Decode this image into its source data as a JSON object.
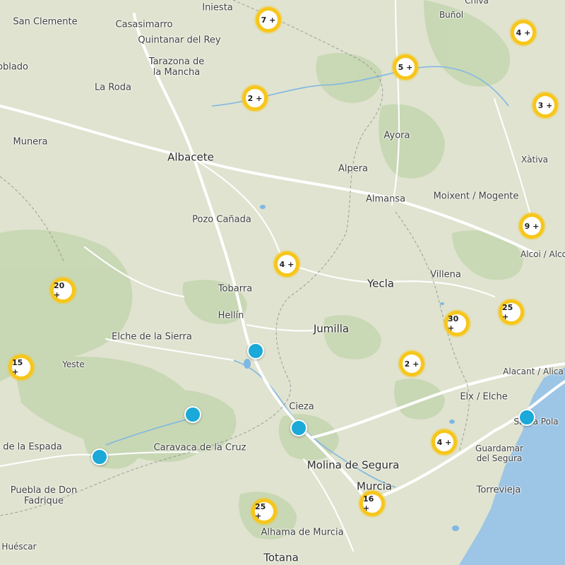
{
  "map": {
    "colors": {
      "land": "#dfe3cf",
      "forest": "#c5d6b0",
      "sea": "#9cc5e6",
      "road": "#ffffff",
      "border": "#8c8c8c",
      "river": "#7fb7e3",
      "cluster_ring": "#f7c61b",
      "marker": "#1aa9d8"
    },
    "places": [
      {
        "name": "Iniesta"
      },
      {
        "name": "Buñol"
      },
      {
        "name": "Chiva"
      },
      {
        "name": "San Clemente"
      },
      {
        "name": "Casasimarro"
      },
      {
        "name": "Quintanar del Rey"
      },
      {
        "name": "Tarazona de\nla Mancha"
      },
      {
        "name": "La Roda"
      },
      {
        "name": "oblado"
      },
      {
        "name": "Munera"
      },
      {
        "name": "Albacete"
      },
      {
        "name": "Ayora"
      },
      {
        "name": "Alpera"
      },
      {
        "name": "Xàtiva"
      },
      {
        "name": "Almansa"
      },
      {
        "name": "Moixent / Mogente"
      },
      {
        "name": "Pozo Cañada"
      },
      {
        "name": "Alcoi / Alco"
      },
      {
        "name": "Villena"
      },
      {
        "name": "Yecla"
      },
      {
        "name": "Tobarra"
      },
      {
        "name": "Hellín"
      },
      {
        "name": "Jumilla"
      },
      {
        "name": "Elche de la Sierra"
      },
      {
        "name": "Yeste"
      },
      {
        "name": "Alacant / Alica"
      },
      {
        "name": "Elx / Elche"
      },
      {
        "name": "Cieza"
      },
      {
        "name": "Santa Pola"
      },
      {
        "name": "o de la Espada"
      },
      {
        "name": "Caravaca de la Cruz"
      },
      {
        "name": "Guardamar\ndel Segura"
      },
      {
        "name": "Molina de Segura"
      },
      {
        "name": "Puebla de Don\nFadrique"
      },
      {
        "name": "Murcia"
      },
      {
        "name": "Torrevieja"
      },
      {
        "name": "Huéscar"
      },
      {
        "name": "Alhama de Murcia"
      },
      {
        "name": "Totana"
      }
    ],
    "clusters": [
      {
        "label": "7 +"
      },
      {
        "label": "4 +"
      },
      {
        "label": "5 +"
      },
      {
        "label": "2 +"
      },
      {
        "label": "3 +"
      },
      {
        "label": "9 +"
      },
      {
        "label": "4 +"
      },
      {
        "label": "20 +"
      },
      {
        "label": "25 +"
      },
      {
        "label": "30 +"
      },
      {
        "label": "15 +"
      },
      {
        "label": "2 +"
      },
      {
        "label": "4 +"
      },
      {
        "label": "16 +"
      },
      {
        "label": "25 +"
      }
    ],
    "markers": [
      {},
      {},
      {},
      {},
      {}
    ]
  }
}
